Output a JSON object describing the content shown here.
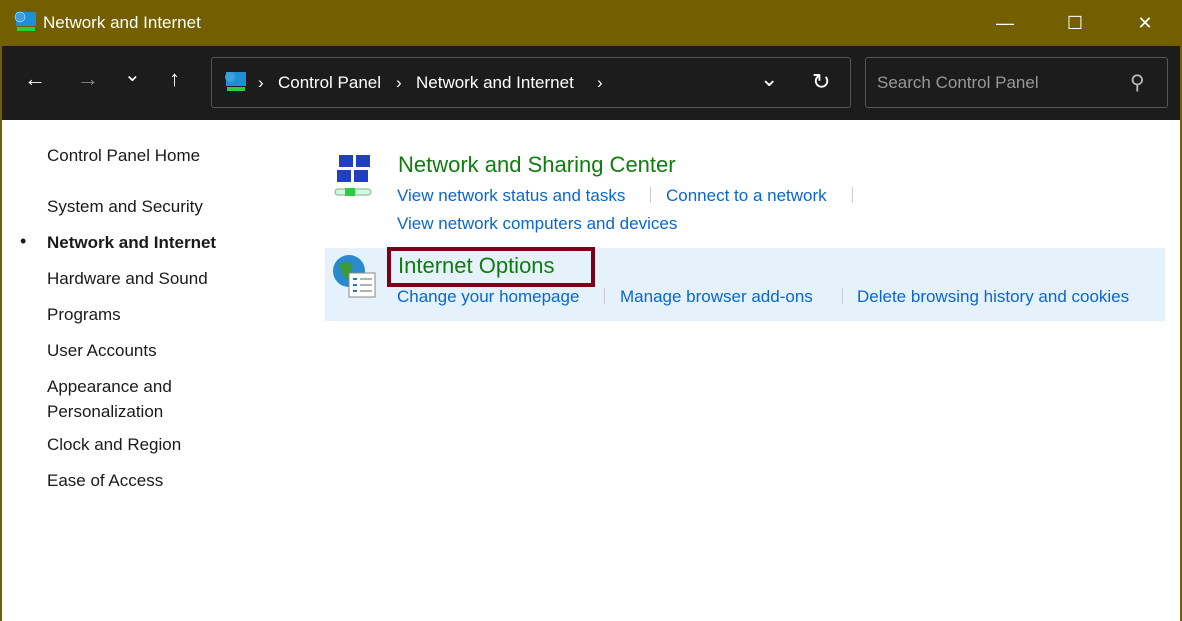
{
  "window": {
    "title": "Network and Internet",
    "minimize": "—",
    "maximize": "☐",
    "close": "✕"
  },
  "toolbar": {
    "back": "←",
    "forward": "→",
    "recent": "⌄",
    "up": "↑",
    "breadcrumb": [
      "Control Panel",
      "Network and Internet"
    ],
    "sep": "›",
    "dropdown": "⌄",
    "refresh": "↻",
    "search_placeholder": "Search Control Panel",
    "search_icon": "⚲"
  },
  "sidebar": {
    "home": "Control Panel Home",
    "items": [
      "System and Security",
      "Network and Internet",
      "Hardware and Sound",
      "Programs",
      "User Accounts",
      "Appearance and",
      "Personalization",
      "Clock and Region",
      "Ease of Access"
    ],
    "active_bullet": "•"
  },
  "sections": [
    {
      "title": "Network and Sharing Center",
      "links": [
        "View network status and tasks",
        "Connect to a network",
        "View network computers and devices"
      ]
    },
    {
      "title": "Internet Options",
      "links": [
        "Change your homepage",
        "Manage browser add-ons",
        "Delete browsing history and cookies"
      ]
    }
  ],
  "colors": {
    "titlebar": "#735e00",
    "heading": "#107c10",
    "link": "#0a66d0",
    "highlight": "#e5f1fb",
    "focus_box": "#7a0019"
  }
}
